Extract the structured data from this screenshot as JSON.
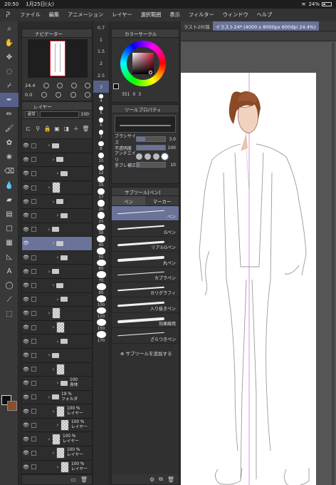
{
  "status": {
    "time": "20:50",
    "date": "1月25日(火)",
    "battery": "24%"
  },
  "menu": [
    "ファイル",
    "編集",
    "アニメーション",
    "レイヤー",
    "選択範囲",
    "表示",
    "フィルター",
    "ウィンドウ",
    "ヘルプ"
  ],
  "toolbox": [
    "pen-icon",
    "zoom-icon",
    "hand-icon",
    "move-icon",
    "lasso-icon",
    "eyedropper-icon",
    "pen-tool-icon",
    "pencil-icon",
    "brush-icon",
    "airbrush-icon",
    "decoration-icon",
    "eraser-icon",
    "blend-icon",
    "fill-icon",
    "gradient-icon",
    "figure-icon",
    "frame-icon",
    "ruler-icon",
    "text-icon",
    "balloon-icon",
    "correct-line-icon",
    "select-icon"
  ],
  "colors": {
    "main": "#0e0e14",
    "sub": "#8b4f2e",
    "accent": "#6b7399"
  },
  "navigator": {
    "title": "ナビゲーター",
    "zoom": "24.4",
    "rotate": "0.0"
  },
  "brush_sizes": [
    "0.7",
    "1",
    "1.5",
    "2",
    "2.5",
    "3",
    "4",
    "5",
    "6",
    "7",
    "8",
    "10",
    "12",
    "15",
    "17",
    "20",
    "25",
    "30",
    "40",
    "50",
    "60",
    "70",
    "80",
    "100",
    "120",
    "150",
    "170"
  ],
  "layers": {
    "title": "レイヤー",
    "blend": "通常",
    "opacity": "100",
    "rows": [
      {
        "type": "folder",
        "line1": "",
        "line2": ""
      },
      {
        "type": "folder",
        "line1": "",
        "line2": ""
      },
      {
        "type": "folder",
        "line1": "",
        "line2": ""
      },
      {
        "type": "thumb",
        "line1": "",
        "line2": ""
      },
      {
        "type": "folder",
        "line1": "",
        "line2": ""
      },
      {
        "type": "folder",
        "line1": "",
        "line2": ""
      },
      {
        "type": "folder",
        "line1": "",
        "line2": ""
      },
      {
        "type": "folder",
        "line1": "",
        "line2": ""
      },
      {
        "type": "folder",
        "line1": "",
        "line2": ""
      },
      {
        "type": "folder",
        "line1": "",
        "line2": ""
      },
      {
        "type": "folder",
        "line1": "",
        "line2": ""
      },
      {
        "type": "folder",
        "line1": "",
        "line2": ""
      },
      {
        "type": "thumb",
        "line1": "",
        "line2": ""
      },
      {
        "type": "thumb",
        "line1": "",
        "line2": ""
      },
      {
        "type": "folder",
        "line1": "",
        "line2": ""
      },
      {
        "type": "folder",
        "line1": "",
        "line2": ""
      },
      {
        "type": "thumb",
        "line1": "",
        "line2": ""
      },
      {
        "type": "folder",
        "line1": "100",
        "line2": "身体"
      },
      {
        "type": "folder",
        "line1": "19 %",
        "line2": "フォルダ"
      },
      {
        "type": "thumb",
        "line1": "100 %",
        "line2": "レイヤー"
      },
      {
        "type": "thumb",
        "line1": "100 %",
        "line2": "レイヤー"
      },
      {
        "type": "thumb",
        "line1": "100 %",
        "line2": "レイヤー"
      },
      {
        "type": "thumb",
        "line1": "100 %",
        "line2": "レイヤー"
      },
      {
        "type": "thumb",
        "line1": "100 %",
        "line2": "レイヤー"
      }
    ]
  },
  "color_circle": {
    "title": "カラーサークル",
    "h": "351",
    "s": "0",
    "v": "3"
  },
  "tool_property": {
    "title": "ツールプロパティ",
    "brush_size_label": "ブラシサイズ",
    "brush_size": "3.0",
    "opacity_label": "不透明度",
    "opacity": "100",
    "antialias_label": "アンチエイリ",
    "stabilization_label": "手ブレ補正",
    "stabilization": "10"
  },
  "subtool": {
    "title": "サブツール[ペン]",
    "tabs": [
      "ペン",
      "マーカー"
    ],
    "items": [
      "ペン",
      "Gペン",
      "リアルGペン",
      "丸ペン",
      "カブラペン",
      "カリグラフィ",
      "入り抜きペン",
      "効果線用",
      "ざらつきペン"
    ],
    "add_label": "サブツールを追加する"
  },
  "canvas": {
    "tabs": [
      "ラスト20(保",
      "イラスト24* (4000 x 8000px 600dpi 24.4%)"
    ]
  }
}
